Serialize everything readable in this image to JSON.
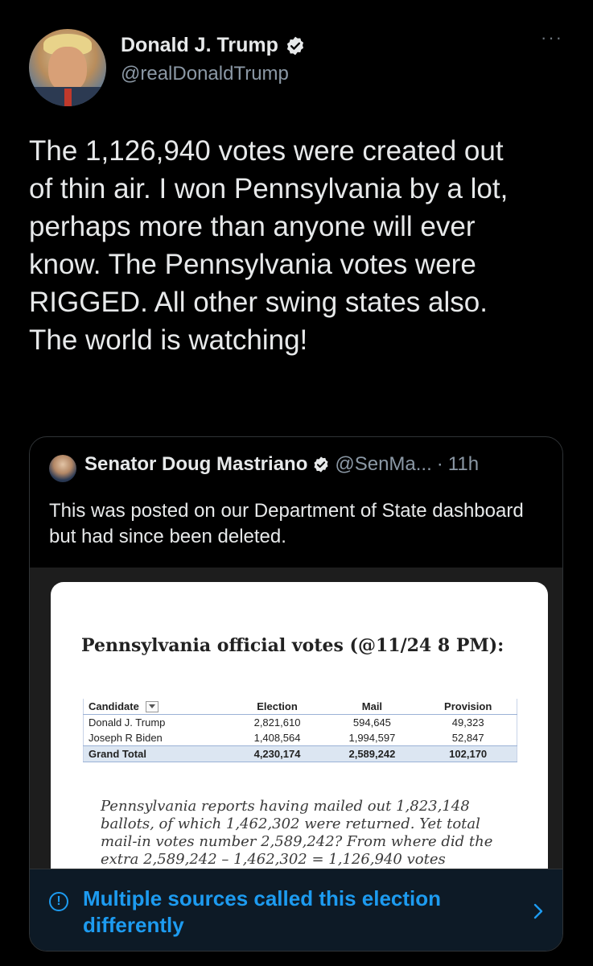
{
  "author": {
    "name": "Donald J. Trump",
    "handle": "@realDonaldTrump"
  },
  "tweet": {
    "text": "The 1,126,940 votes were created out\nof thin air. I won Pennsylvania by a lot,\nperhaps more than anyone will ever\nknow. The Pennsylvania votes were\nRIGGED. All other swing states also.\nThe world is watching!"
  },
  "more_label": "···",
  "quote": {
    "name": "Senator Doug Mastriano",
    "handle": "@SenMa...",
    "separator": "·",
    "time": "11h",
    "text": "This was posted on our Department of State dashboard but had since been deleted.",
    "media": {
      "title": "Pennsylvania official votes (@11/24 8 PM):",
      "table": {
        "headers": [
          "Candidate",
          "Election",
          "Mail",
          "Provision"
        ],
        "rows": [
          [
            "Donald J. Trump",
            "2,821,610",
            "594,645",
            "49,323"
          ],
          [
            "Joseph R Biden",
            "1,408,564",
            "1,994,597",
            "52,847"
          ]
        ],
        "total": [
          "Grand Total",
          "4,230,174",
          "2,589,242",
          "102,170"
        ]
      },
      "note": "Pennsylvania reports having mailed out 1,823,148 ballots, of which 1,462,302 were returned. Yet total mail-in votes number 2,589,242? From where did the extra 2,589,242 – 1,462,302 = 1,126,940 votes"
    }
  },
  "notice": {
    "icon": "!",
    "text": "Multiple sources called this election differently"
  },
  "colors": {
    "accent": "#1d9bf0",
    "background": "#000000",
    "muted": "#8b98a5"
  }
}
